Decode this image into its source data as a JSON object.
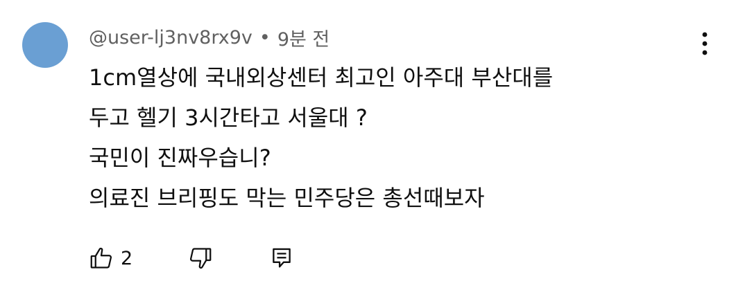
{
  "comment": {
    "author": "@user-lj3nv8rx9v",
    "separator": "•",
    "time": "9분 전",
    "lines": [
      "1cm열상에 국내외상센터 최고인 아주대 부산대를",
      "두고 헬기 3시간타고 서울대 ?",
      "국민이 진짜우습니?",
      "의료진 브리핑도 막는 민주당은 총선때보자"
    ],
    "like_count": "2",
    "avatar_color": "#6a9fd3"
  },
  "icons": {
    "menu": "vertical-dots-icon",
    "like": "thumbs-up-icon",
    "dislike": "thumbs-down-icon",
    "reply": "reply-comment-icon"
  }
}
